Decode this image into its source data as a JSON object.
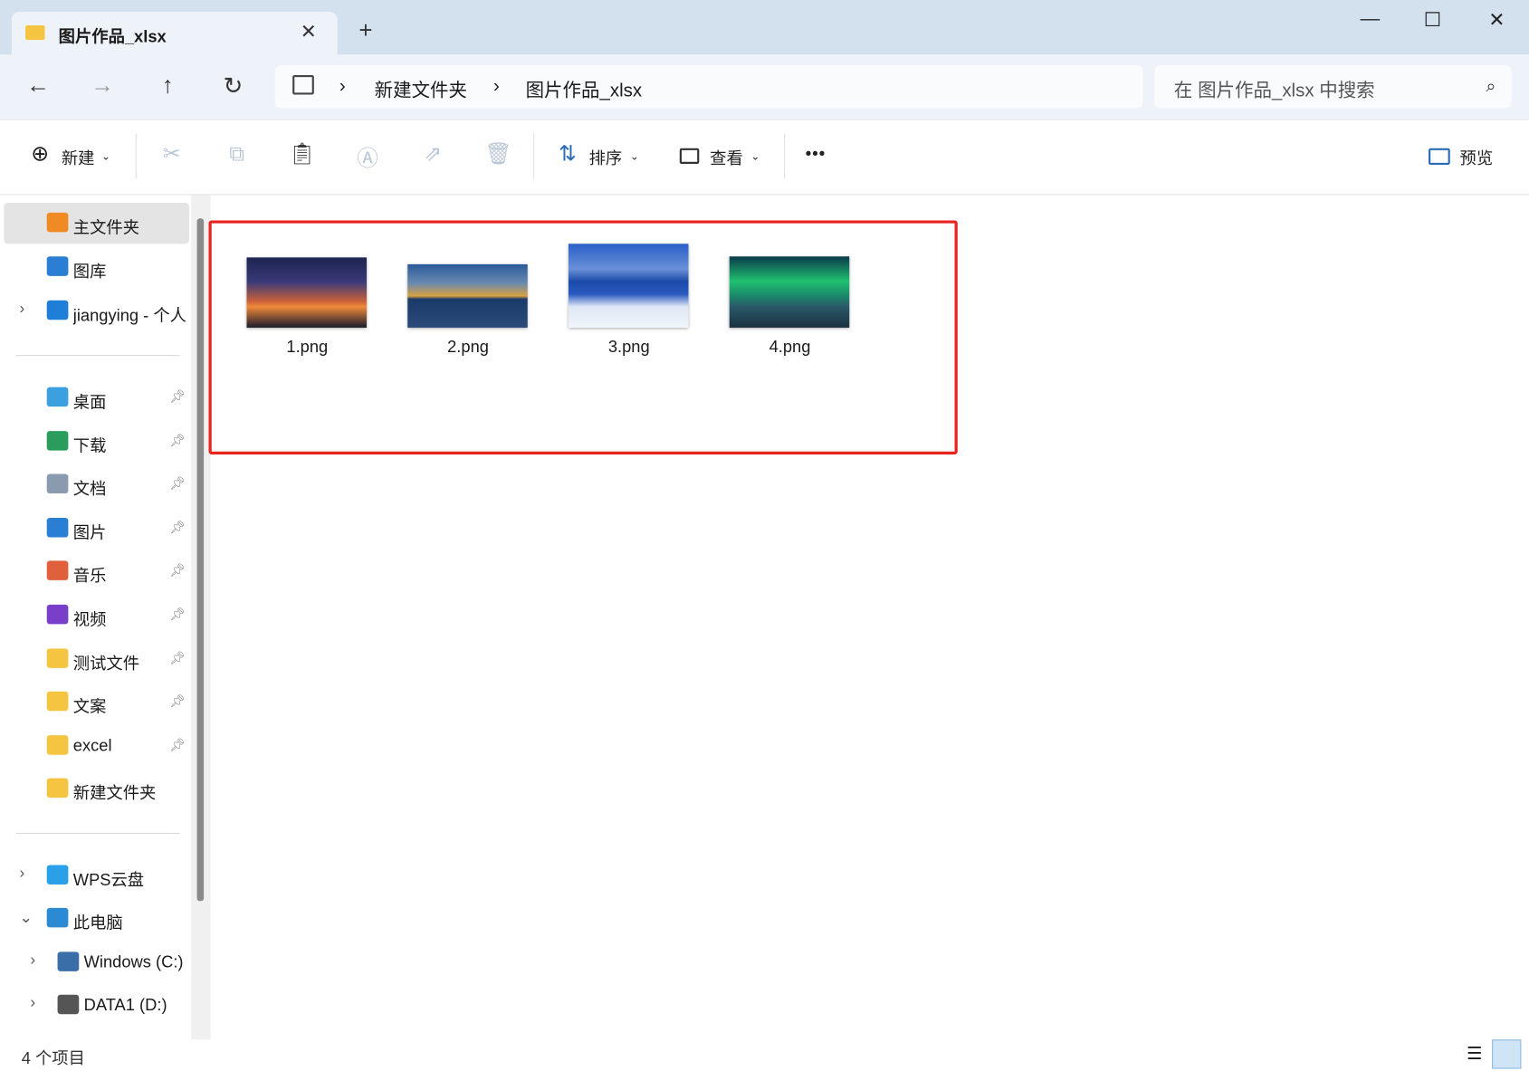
{
  "window": {
    "tab_title": "图片作品_xlsx",
    "new_tab": "+",
    "close_tab": "✕",
    "minimize": "—",
    "maximize": "☐",
    "close": "✕"
  },
  "nav": {
    "back": "←",
    "forward": "→",
    "up": "↑",
    "refresh": "↻",
    "breadcrumb": [
      "新建文件夹",
      "图片作品_xlsx"
    ],
    "search_placeholder": "在 图片作品_xlsx 中搜索"
  },
  "toolbar": {
    "new": "新建",
    "sort": "排序",
    "view": "查看",
    "more": "•••",
    "preview": "预览"
  },
  "sidebar": {
    "top": [
      {
        "label": "主文件夹",
        "color": "#f08a24"
      },
      {
        "label": "图库",
        "color": "#2a7fd4"
      },
      {
        "label": "jiangying - 个人",
        "color": "#1f7fd8"
      }
    ],
    "pinned": [
      {
        "label": "桌面",
        "color": "#3aa0e0"
      },
      {
        "label": "下载",
        "color": "#2a9d5c"
      },
      {
        "label": "文档",
        "color": "#8a9bb0"
      },
      {
        "label": "图片",
        "color": "#2a7fd4"
      },
      {
        "label": "音乐",
        "color": "#e0603c"
      },
      {
        "label": "视频",
        "color": "#7a3fc8"
      },
      {
        "label": "测试文件",
        "color": "#f5c542"
      },
      {
        "label": "文案",
        "color": "#f5c542"
      },
      {
        "label": "excel",
        "color": "#f5c542"
      },
      {
        "label": "新建文件夹",
        "color": "#f5c542"
      }
    ],
    "bottom": [
      {
        "label": "WPS云盘",
        "color": "#2aa0e8"
      },
      {
        "label": "此电脑",
        "color": "#2a8ad4"
      },
      {
        "label": "Windows (C:)",
        "color": "#3a6ea8"
      },
      {
        "label": "DATA1 (D:)",
        "color": "#555"
      }
    ]
  },
  "files": [
    {
      "name": "1.png"
    },
    {
      "name": "2.png"
    },
    {
      "name": "3.png"
    },
    {
      "name": "4.png"
    }
  ],
  "status": {
    "count": "4 个项目"
  }
}
